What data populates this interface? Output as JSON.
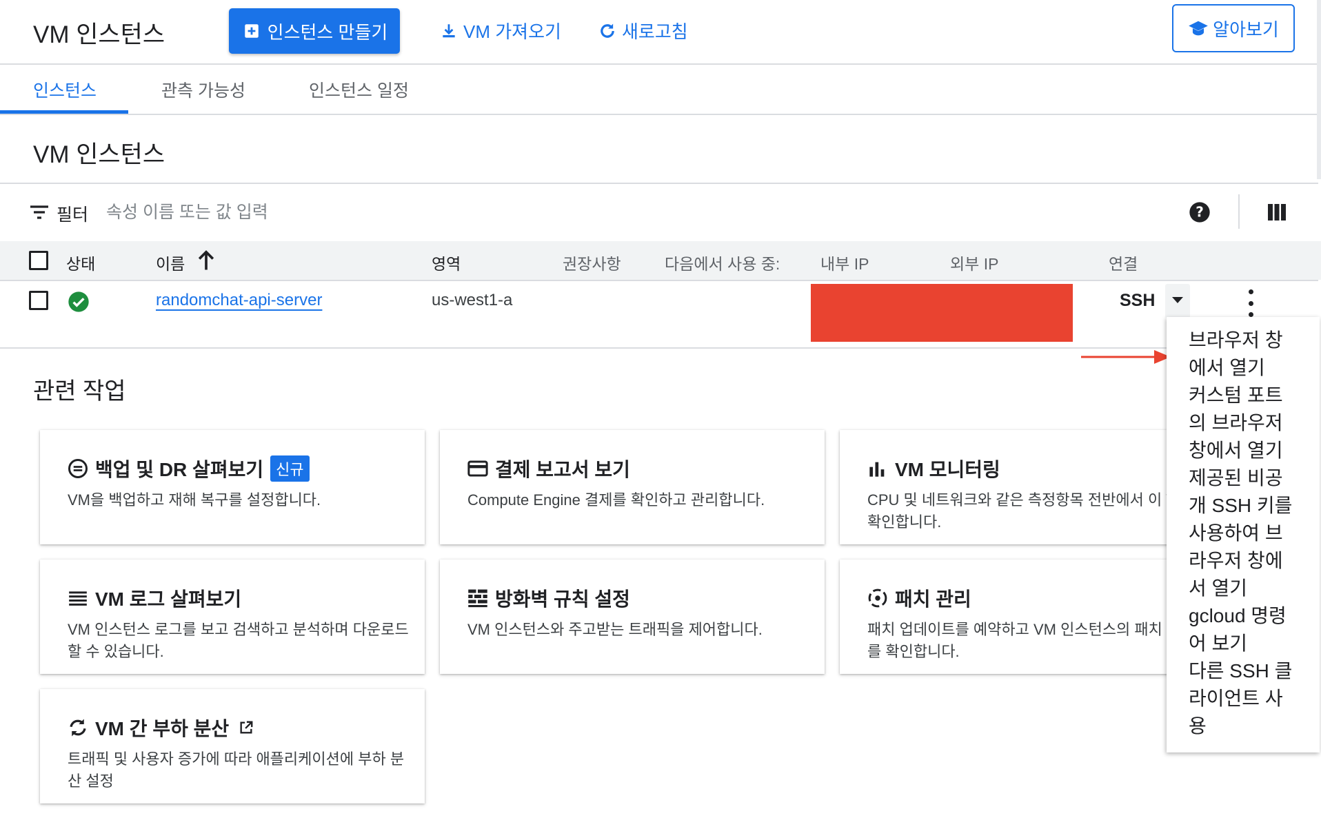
{
  "header": {
    "title": "VM 인스턴스",
    "create_label": "인스턴스 만들기",
    "import_label": "VM 가져오기",
    "refresh_label": "새로고침",
    "learn_label": "알아보기"
  },
  "tabs": [
    {
      "label": "인스턴스",
      "active": true
    },
    {
      "label": "관측 가능성",
      "active": false
    },
    {
      "label": "인스턴스 일정",
      "active": false
    }
  ],
  "section_title": "VM 인스턴스",
  "filter": {
    "label": "필터",
    "placeholder": "속성 이름 또는 값 입력"
  },
  "table": {
    "headers": {
      "status": "상태",
      "name": "이름",
      "zone": "영역",
      "recommendation": "권장사항",
      "in_use_by": "다음에서 사용 중:",
      "internal_ip": "내부 IP",
      "external_ip": "외부 IP",
      "connect": "연결"
    },
    "rows": [
      {
        "name": "randomchat-api-server",
        "zone": "us-west1-a",
        "connect": "SSH",
        "status": "running"
      }
    ]
  },
  "related": {
    "title": "관련 작업",
    "cards": [
      {
        "icon": "backup-icon",
        "title": "백업 및 DR 살펴보기",
        "badge": "신규",
        "desc": "VM을 백업하고 재해 복구를 설정합니다."
      },
      {
        "icon": "billing-card-icon",
        "title": "결제 보고서 보기",
        "desc": "Compute Engine 결제를 확인하고 관리합니다."
      },
      {
        "icon": "bar-chart-icon",
        "title": "VM 모니터링",
        "desc": "CPU 및 네트워크와 같은 측정항목 전반에서 이 VM을 확인합니다."
      },
      {
        "icon": "logs-icon",
        "title": "VM 로그 살펴보기",
        "desc": "VM 인스턴스 로그를 보고 검색하고 분석하며 다운로드할 수 있습니다."
      },
      {
        "icon": "firewall-icon",
        "title": "방화벽 규칙 설정",
        "desc": "VM 인스턴스와 주고받는 트래픽을 제어합니다."
      },
      {
        "icon": "patch-icon",
        "title": "패치 관리",
        "desc": "패치 업데이트를 예약하고 VM 인스턴스의 패치 정 준수를 확인합니다."
      },
      {
        "icon": "load-balance-icon",
        "title": "VM 간 부하 분산",
        "external": true,
        "desc": "트래픽 및 사용자 증가에 따라 애플리케이션에 부하 분산 설정"
      }
    ]
  },
  "ssh_menu": {
    "items": [
      "브라우저 창에서 열기",
      "커스텀 포트의 브라우저 창에서 열기",
      "제공된 비공개 SSH 키를 사용하여 브라우저 창에서 열기",
      "gcloud 명령어 보기",
      "다른 SSH 클라이언트 사용"
    ]
  },
  "colors": {
    "accent": "#1a73e8",
    "redaction": "#e94330",
    "success": "#1e8e3e"
  }
}
